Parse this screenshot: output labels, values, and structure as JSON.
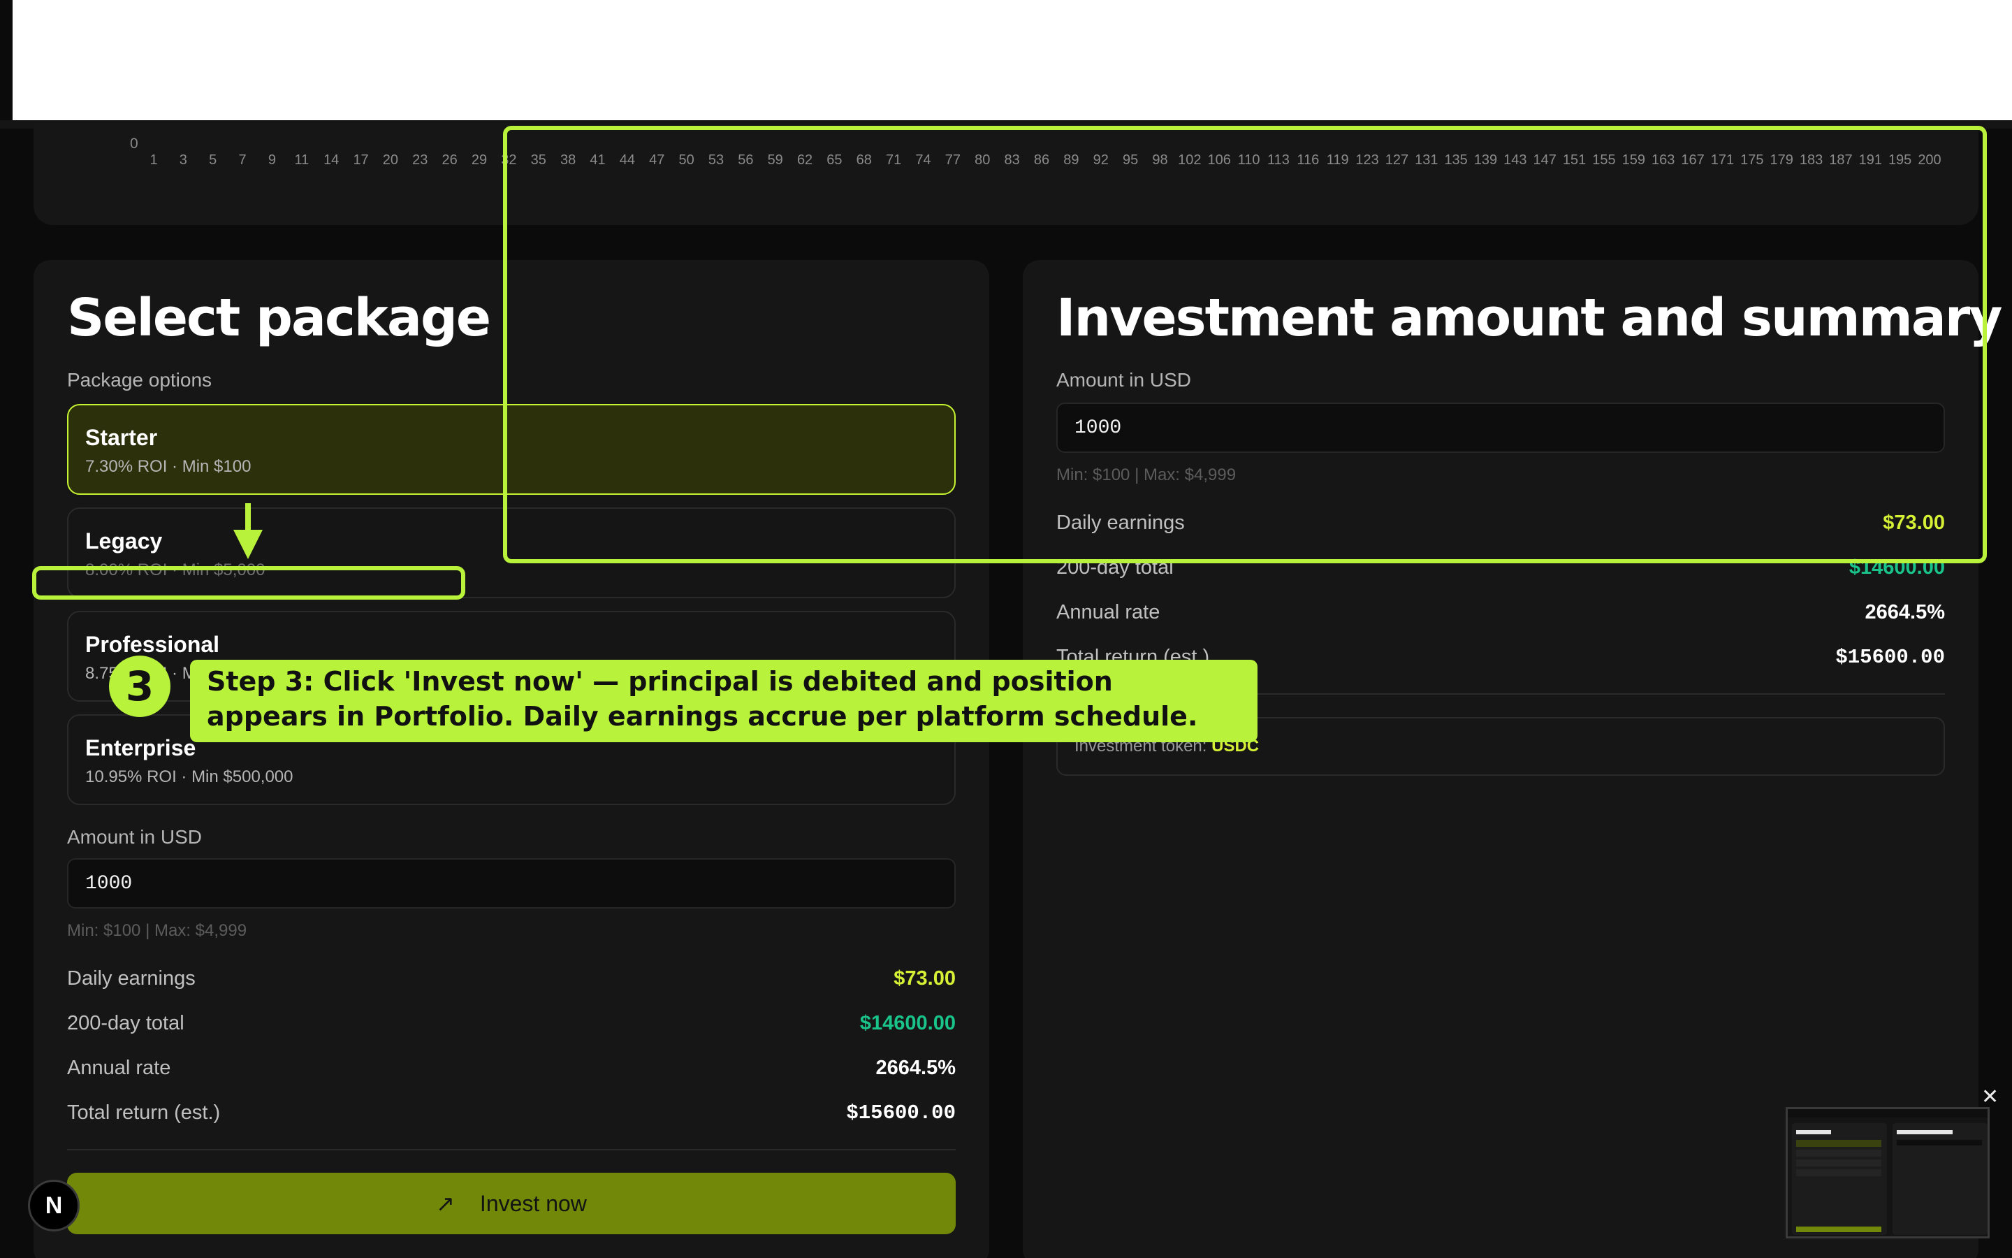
{
  "chart": {
    "y_zero_label": "0",
    "x_ticks": [
      "1",
      "3",
      "5",
      "7",
      "9",
      "11",
      "14",
      "17",
      "20",
      "23",
      "26",
      "29",
      "32",
      "35",
      "38",
      "41",
      "44",
      "47",
      "50",
      "53",
      "56",
      "59",
      "62",
      "65",
      "68",
      "71",
      "74",
      "77",
      "80",
      "83",
      "86",
      "89",
      "92",
      "95",
      "98",
      "102",
      "106",
      "110",
      "113",
      "116",
      "119",
      "123",
      "127",
      "131",
      "135",
      "139",
      "143",
      "147",
      "151",
      "155",
      "159",
      "163",
      "167",
      "171",
      "175",
      "179",
      "183",
      "187",
      "191",
      "195",
      "200"
    ]
  },
  "select_package": {
    "title": "Select package",
    "options_label": "Package options",
    "packages": [
      {
        "name": "Starter",
        "detail": "7.30% ROI · Min $100",
        "selected": true
      },
      {
        "name": "Legacy",
        "detail": "8.00% ROI · Min $5,000",
        "selected": false
      },
      {
        "name": "Professional",
        "detail": "8.75% ROI · Min",
        "selected": false
      },
      {
        "name": "Enterprise",
        "detail": "10.95% ROI · Min $500,000",
        "selected": false
      }
    ],
    "amount_label": "Amount in USD",
    "amount_value": "1000",
    "amount_hint": "Min: $100 | Max: $4,999",
    "rows": [
      {
        "label": "Daily earnings",
        "value": "$73.00"
      },
      {
        "label": "200-day total",
        "value": "$14600.00"
      },
      {
        "label": "Annual rate",
        "value": "2664.5%"
      },
      {
        "label": "Total return (est.)",
        "value": "$15600.00"
      }
    ],
    "invest_button": {
      "icon": "↗",
      "label": "Invest now"
    }
  },
  "summary": {
    "title": "Investment amount and summary",
    "amount_label": "Amount in USD",
    "amount_value": "1000",
    "amount_hint": "Min: $100 | Max: $4,999",
    "rows": [
      {
        "label": "Daily earnings",
        "value": "$73.00"
      },
      {
        "label": "200-day total",
        "value": "$14600.00"
      },
      {
        "label": "Annual rate",
        "value": "2664.5%"
      },
      {
        "label": "Total return (est.)",
        "value": "$15600.00"
      }
    ],
    "token_label": "Investment token:",
    "token_value": "USDC"
  },
  "annotation": {
    "step_number": "3",
    "step_text": "Step 3: Click 'Invest now' — principal is debited and position appears in Portfolio. Daily earnings accrue per platform schedule."
  },
  "corner_badge": "N",
  "thumbnail_close": "✕",
  "colors": {
    "accent": "#c6f432",
    "annotation": "#b9f23b",
    "green": "#19c38a",
    "button": "#728808"
  }
}
